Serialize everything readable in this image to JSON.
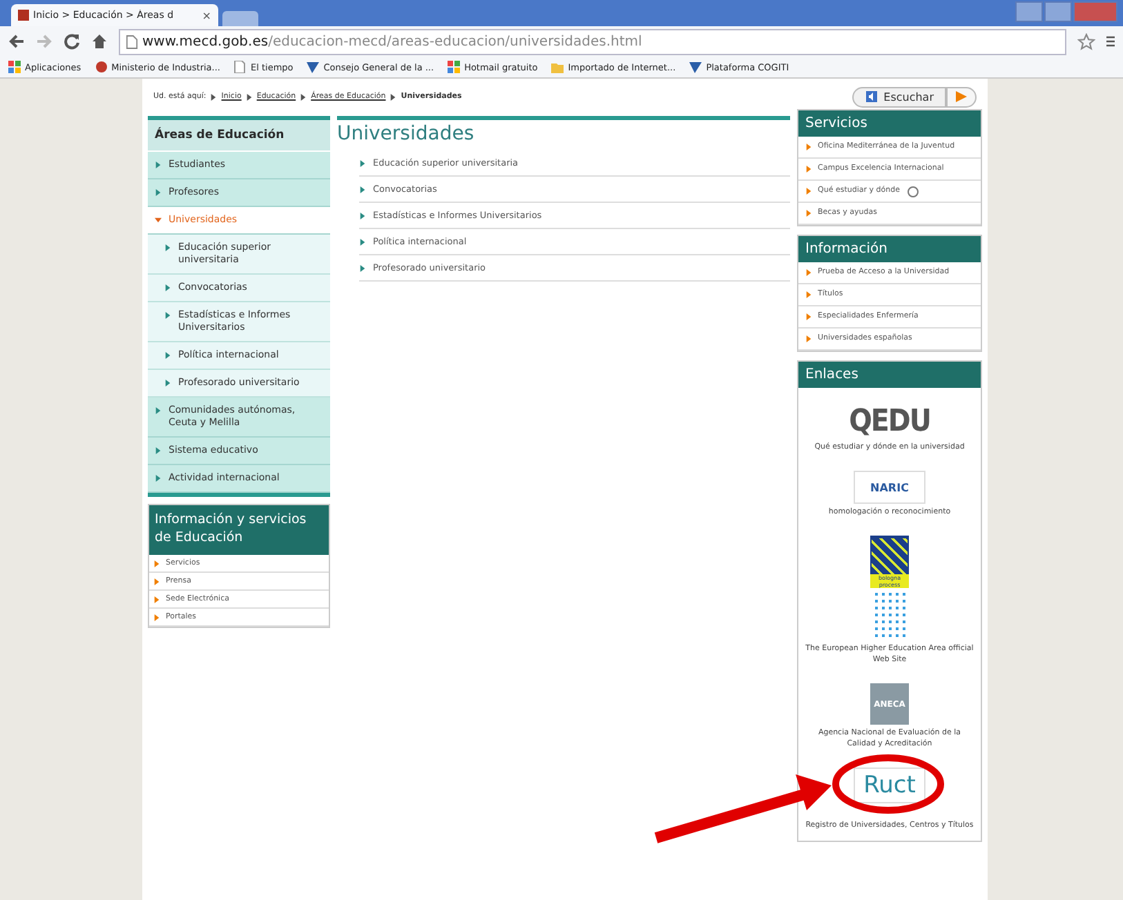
{
  "browser": {
    "tab": {
      "title": "Inicio > Educación > Áreas d",
      "close": "×"
    },
    "address": {
      "domain": "www.mecd.gob.es",
      "path": "/educacion-mecd/areas-educacion/universidades.html"
    },
    "bookmarks": [
      {
        "label": "Aplicaciones",
        "kind": "apps"
      },
      {
        "label": "Ministerio de Industria...",
        "kind": "site"
      },
      {
        "label": "El tiempo",
        "kind": "page"
      },
      {
        "label": "Consejo General de la ...",
        "kind": "arrow"
      },
      {
        "label": "Hotmail gratuito",
        "kind": "apps"
      },
      {
        "label": "Importado de Internet...",
        "kind": "folder"
      },
      {
        "label": "Plataforma COGITI",
        "kind": "arrow"
      }
    ]
  },
  "breadcrumb": {
    "label": "Ud. está aquí:",
    "items": [
      {
        "text": "Inicio",
        "current": false
      },
      {
        "text": "Educación",
        "current": false
      },
      {
        "text": "Áreas de Educación",
        "current": false
      },
      {
        "text": "Universidades",
        "current": true
      }
    ]
  },
  "listen_button": "Escuchar",
  "left_nav": {
    "title": "Áreas de Educación",
    "items": [
      {
        "label": "Estudiantes",
        "selected": false,
        "expanded": false
      },
      {
        "label": "Profesores",
        "selected": false,
        "expanded": false
      },
      {
        "label": "Universidades",
        "selected": true,
        "expanded": true,
        "children": [
          {
            "label": "Educación superior universitaria"
          },
          {
            "label": "Convocatorias"
          },
          {
            "label": "Estadísticas e Informes Universitarios"
          },
          {
            "label": "Política internacional"
          },
          {
            "label": "Profesorado universitario"
          }
        ]
      },
      {
        "label": "Comunidades autónomas, Ceuta y Melilla",
        "selected": false,
        "expanded": false
      },
      {
        "label": "Sistema educativo",
        "selected": false,
        "expanded": false
      },
      {
        "label": "Actividad internacional",
        "selected": false,
        "expanded": false
      }
    ]
  },
  "info_panel": {
    "title": "Información y servicios de Educación",
    "links": [
      "Servicios",
      "Prensa",
      "Sede Electrónica",
      "Portales"
    ]
  },
  "main": {
    "title": "Universidades",
    "links": [
      "Educación superior universitaria",
      "Convocatorias",
      "Estadísticas e Informes Universitarios",
      "Política internacional",
      "Profesorado universitario"
    ]
  },
  "services": {
    "title": "Servicios",
    "items": [
      {
        "label": "Oficina Mediterránea de la Juventud",
        "external": false
      },
      {
        "label": "Campus Excelencia Internacional",
        "external": false
      },
      {
        "label": "Qué estudiar y dónde",
        "external": true
      },
      {
        "label": "Becas y ayudas",
        "external": false
      }
    ]
  },
  "information": {
    "title": "Información",
    "items": [
      "Prueba de Acceso a la Universidad",
      "Títulos",
      "Especialidades Enfermería",
      "Universidades españolas"
    ]
  },
  "links": {
    "title": "Enlaces",
    "items": [
      {
        "kind": "qedu",
        "logo": "QEDU",
        "caption": "Qué estudiar y dónde en la universidad"
      },
      {
        "kind": "naric",
        "logo": "NARIC",
        "caption": "homologación o reconocimiento"
      },
      {
        "kind": "bologna",
        "logo": "bologna process",
        "caption": "The European Higher Education Area official Web Site"
      },
      {
        "kind": "aneca",
        "logo": "ANECA",
        "caption": "Agencia Nacional de Evaluación de la Calidad y Acreditación"
      },
      {
        "kind": "ruct",
        "logo": "Ruct",
        "caption": "Registro de Universidades, Centros y Títulos"
      }
    ]
  }
}
